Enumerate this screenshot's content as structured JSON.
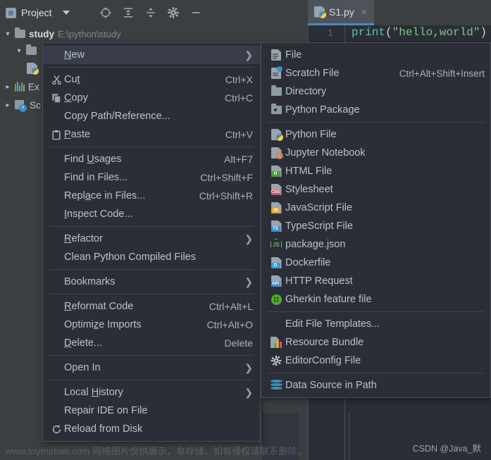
{
  "toolbar": {
    "project_label": "Project",
    "icons": [
      {
        "name": "locate-target-icon"
      },
      {
        "name": "expand-all-icon"
      },
      {
        "name": "collapse-all-icon"
      },
      {
        "name": "settings-gear-icon"
      },
      {
        "name": "hide-panel-icon"
      }
    ]
  },
  "editor_tab": {
    "title": "S1.py",
    "close": "×",
    "icon": "python-file-icon"
  },
  "tree": {
    "root": {
      "name": "study",
      "path": "E:\\python\\study"
    },
    "items": [
      {
        "label": "Ex",
        "icon": "external-libraries-icon"
      },
      {
        "label": "Sc",
        "icon": "scratches-consoles-icon"
      }
    ]
  },
  "editor": {
    "line_number": "1",
    "code": {
      "fn": "print",
      "open": "(",
      "string": "\"hello,world\"",
      "close": ")"
    }
  },
  "context_menu": {
    "groups": [
      [
        {
          "label": "New",
          "mnemonic": "N",
          "submenu": true,
          "selected": true,
          "icon": null,
          "accel": ""
        }
      ],
      [
        {
          "label": "Cut",
          "mnemonic": "t",
          "accel": "Ctrl+X",
          "icon": "scissors-icon"
        },
        {
          "label": "Copy",
          "mnemonic": "C",
          "accel": "Ctrl+C",
          "icon": "copy-icon"
        },
        {
          "label": "Copy Path/Reference...",
          "mnemonic": "",
          "accel": "",
          "icon": null
        },
        {
          "label": "Paste",
          "mnemonic": "P",
          "accel": "Ctrl+V",
          "icon": "clipboard-icon"
        }
      ],
      [
        {
          "label": "Find Usages",
          "mnemonic": "U",
          "accel": "Alt+F7",
          "icon": null
        },
        {
          "label": "Find in Files...",
          "mnemonic": "",
          "accel": "Ctrl+Shift+F",
          "icon": null
        },
        {
          "label": "Replace in Files...",
          "mnemonic": "a",
          "accel": "Ctrl+Shift+R",
          "icon": null
        },
        {
          "label": "Inspect Code...",
          "mnemonic": "I",
          "accel": "",
          "icon": null
        }
      ],
      [
        {
          "label": "Refactor",
          "mnemonic": "R",
          "accel": "",
          "submenu": true,
          "icon": null
        },
        {
          "label": "Clean Python Compiled Files",
          "mnemonic": "",
          "accel": "",
          "icon": null
        }
      ],
      [
        {
          "label": "Bookmarks",
          "mnemonic": "",
          "accel": "",
          "submenu": true,
          "icon": null
        }
      ],
      [
        {
          "label": "Reformat Code",
          "mnemonic": "R",
          "accel": "Ctrl+Alt+L",
          "icon": null
        },
        {
          "label": "Optimize Imports",
          "mnemonic": "z",
          "accel": "Ctrl+Alt+O",
          "icon": null
        },
        {
          "label": "Delete...",
          "mnemonic": "D",
          "accel": "Delete",
          "icon": null
        }
      ],
      [
        {
          "label": "Open In",
          "mnemonic": "",
          "accel": "",
          "submenu": true,
          "icon": null
        }
      ],
      [
        {
          "label": "Local History",
          "mnemonic": "H",
          "accel": "",
          "submenu": true,
          "icon": null
        },
        {
          "label": "Repair IDE on File",
          "mnemonic": "",
          "accel": "",
          "icon": null
        },
        {
          "label": "Reload from Disk",
          "mnemonic": "",
          "accel": "",
          "icon": "reload-icon"
        }
      ]
    ]
  },
  "submenu": {
    "groups": [
      [
        {
          "label": "File",
          "accel": "",
          "icon": "file-icon"
        },
        {
          "label": "Scratch File",
          "accel": "Ctrl+Alt+Shift+Insert",
          "icon": "scratch-file-icon"
        },
        {
          "label": "Directory",
          "accel": "",
          "icon": "directory-icon"
        },
        {
          "label": "Python Package",
          "accel": "",
          "icon": "python-package-icon"
        }
      ],
      [
        {
          "label": "Python File",
          "accel": "",
          "icon": "python-file-icon"
        },
        {
          "label": "Jupyter Notebook",
          "accel": "",
          "icon": "jupyter-notebook-icon"
        },
        {
          "label": "HTML File",
          "accel": "",
          "icon": "html-file-icon",
          "badge": "H",
          "badge_color": "#4a9e35"
        },
        {
          "label": "Stylesheet",
          "accel": "",
          "icon": "stylesheet-icon",
          "badge": "CSS",
          "badge_color": "#c2546a"
        },
        {
          "label": "JavaScript File",
          "accel": "",
          "icon": "javascript-file-icon",
          "badge": "JS",
          "badge_color": "#e5a72c"
        },
        {
          "label": "TypeScript File",
          "accel": "",
          "icon": "typescript-file-icon",
          "badge": "TS",
          "badge_color": "#3a8fd0"
        },
        {
          "label": "package.json",
          "accel": "",
          "icon": "package-json-icon"
        },
        {
          "label": "Dockerfile",
          "accel": "",
          "icon": "dockerfile-icon",
          "badge": "D",
          "badge_color": "#3a9fd0"
        },
        {
          "label": "HTTP Request",
          "accel": "",
          "icon": "http-request-icon",
          "badge": "API",
          "badge_color": "#3a8fd0"
        },
        {
          "label": "Gherkin feature file",
          "accel": "",
          "icon": "gherkin-feature-icon"
        }
      ],
      [
        {
          "label": "Edit File Templates...",
          "accel": "",
          "icon": null
        },
        {
          "label": "Resource Bundle",
          "accel": "",
          "icon": "resource-bundle-icon"
        },
        {
          "label": "EditorConfig File",
          "accel": "",
          "icon": "editorconfig-gear-icon"
        }
      ],
      [
        {
          "label": "Data Source in Path",
          "accel": "",
          "icon": "data-source-icon"
        }
      ]
    ]
  },
  "watermarks": {
    "left": "www.toymoban.com 网络图片仅供展示，非存储，如有侵权请联系删除。",
    "right": "CSDN @Java_默"
  },
  "colors": {
    "menu_bg": "#2b2e37",
    "menu_selected": "#393d4b",
    "panel_bg": "#3c3f41",
    "accent_blue": "#4a88c7",
    "text": "#b5c3d1"
  }
}
